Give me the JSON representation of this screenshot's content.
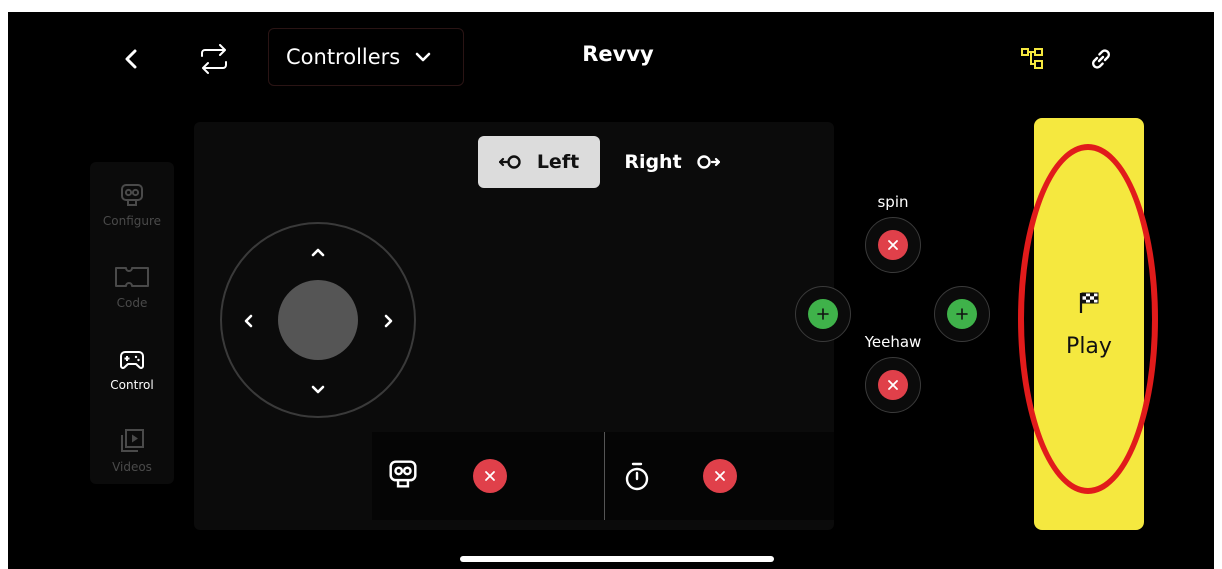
{
  "header": {
    "controller_dropdown_label": "Controllers",
    "title": "Revvy"
  },
  "sidebar": {
    "items": [
      {
        "label": "Configure",
        "icon": "robot-face-icon",
        "active": false
      },
      {
        "label": "Code",
        "icon": "puzzle-piece-icon",
        "active": false
      },
      {
        "label": "Control",
        "icon": "gamepad-icon",
        "active": true
      },
      {
        "label": "Videos",
        "icon": "video-play-icon",
        "active": false
      }
    ]
  },
  "side_toggle": {
    "left_label": "Left",
    "right_label": "Right",
    "selected": "Left"
  },
  "actions": {
    "top_label": "spin",
    "bottom_label": "Yeehaw"
  },
  "play": {
    "label": "Play",
    "icon": "checkered-flag-icon"
  },
  "colors": {
    "background": "#000000",
    "accent_yellow": "#f5e83f",
    "remove_red": "#e0404a",
    "add_green": "#3fb24a",
    "highlight_red": "#e11b1b",
    "toggle_selected": "#dcdcdc"
  }
}
